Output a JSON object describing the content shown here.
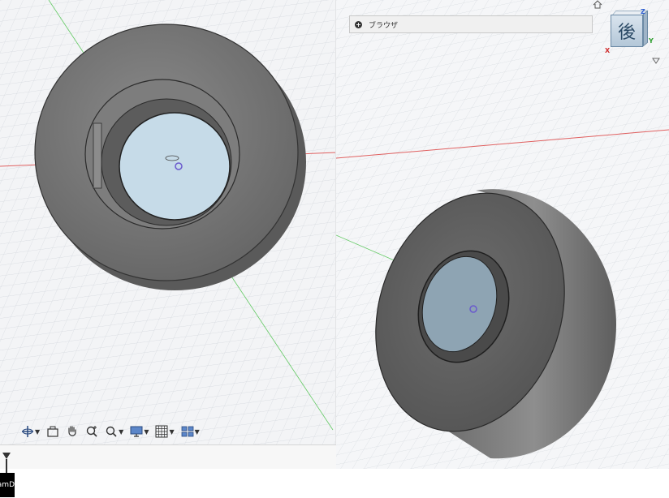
{
  "browser": {
    "label": "ブラウザ",
    "icon": "plus-circle-icon"
  },
  "viewcube": {
    "face_label": "後",
    "x_axis": "X",
    "z_axis": "Z",
    "y_axis": "Y"
  },
  "toolbar": {
    "tools": [
      {
        "name": "orbit-icon",
        "has_menu": true
      },
      {
        "name": "look-at-icon",
        "has_menu": false
      },
      {
        "name": "pan-hand-icon",
        "has_menu": false
      },
      {
        "name": "zoom-icon",
        "has_menu": false
      },
      {
        "name": "fit-zoom-icon",
        "has_menu": true
      },
      {
        "name": "display-settings-icon",
        "has_menu": true
      },
      {
        "name": "grid-icon",
        "has_menu": true
      },
      {
        "name": "viewports-icon",
        "has_menu": true
      }
    ]
  },
  "app_tab": {
    "label": "amD"
  },
  "colors": {
    "grid_line": "#c9ced6",
    "axis_red": "#e06060",
    "axis_green": "#3fbf3f",
    "part_body": "#6e6e6e",
    "hole_glass": "#c6dbe8"
  }
}
